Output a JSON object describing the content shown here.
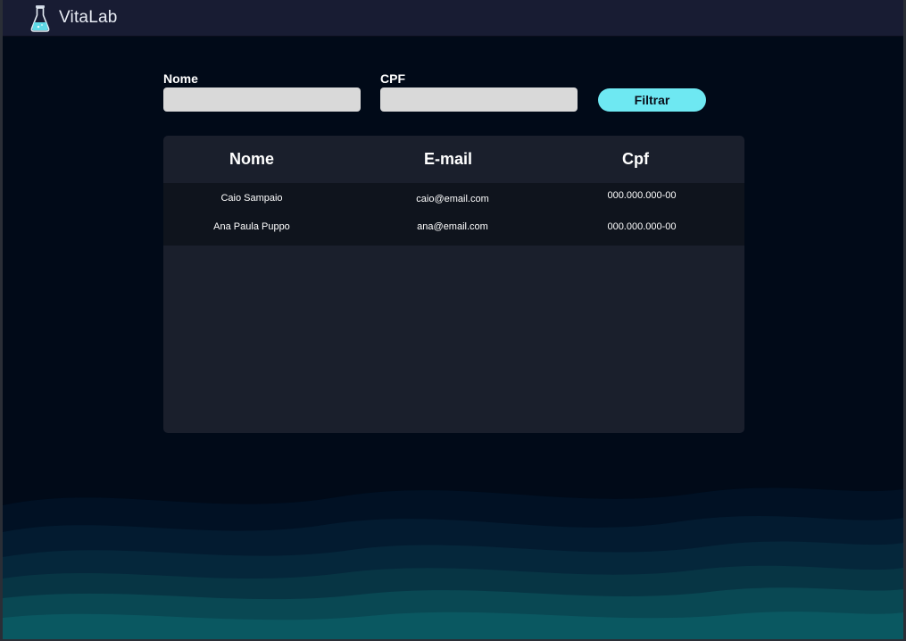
{
  "app": {
    "brand": "VitaLab"
  },
  "filters": {
    "nome_label": "Nome",
    "nome_value": "",
    "cpf_label": "CPF",
    "cpf_value": "",
    "button_label": "Filtrar"
  },
  "table": {
    "headers": [
      "Nome",
      "E-mail",
      "Cpf"
    ],
    "rows": [
      {
        "nome": "Caio Sampaio",
        "email": "caio@email.com",
        "cpf": "000.000.000-00"
      },
      {
        "nome": "Ana Paula Puppo",
        "email": "ana@email.com",
        "cpf": "000.000.000-00"
      }
    ]
  },
  "colors": {
    "background": "#010a18",
    "topbar": "#181c33",
    "accent": "#6ee8f2",
    "input": "#d9d9d9",
    "card": "#1a1f2c",
    "table_body": "#0f141d",
    "wave": "#0b5a63"
  },
  "icons": {
    "logo": "flask-icon"
  }
}
